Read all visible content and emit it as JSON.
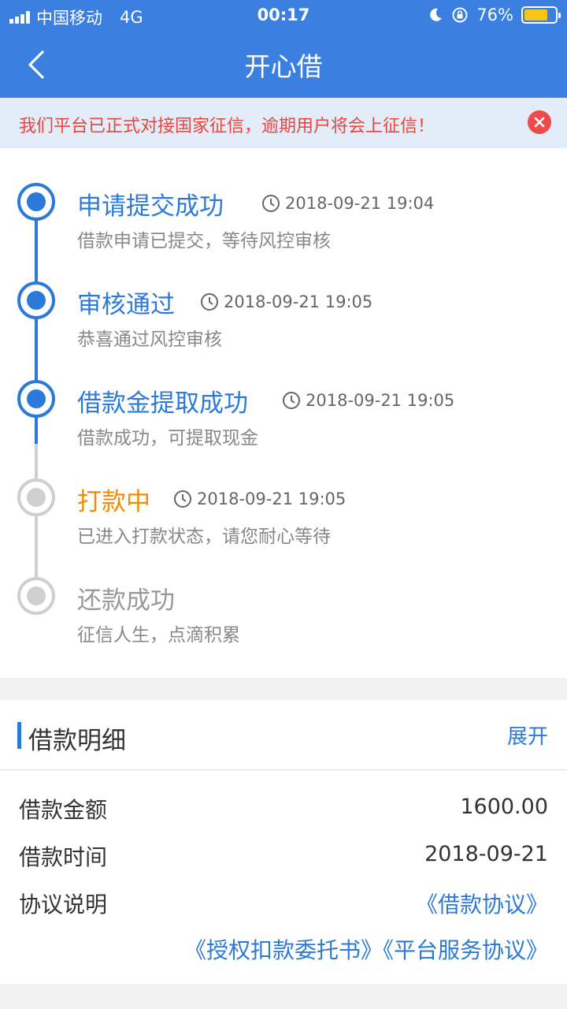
{
  "status_bar": {
    "carrier": "中国移动",
    "network": "4G",
    "time": "00:17",
    "battery": "76%",
    "battery_fill": 0.76
  },
  "nav": {
    "title": "开心借"
  },
  "notice": {
    "text": "我们平台已正式对接国家征信，逾期用户将会上征信！"
  },
  "timeline": {
    "steps": [
      {
        "label": "申请提交成功",
        "time": "2018-09-21 19:04",
        "desc": "借款申请已提交，等待风控审核",
        "state": "done"
      },
      {
        "label": "审核通过",
        "time": "2018-09-21 19:05",
        "desc": "恭喜通过风控审核",
        "state": "done"
      },
      {
        "label": "借款金提取成功",
        "time": "2018-09-21 19:05",
        "desc": "借款成功，可提取现金",
        "state": "done"
      },
      {
        "label": "打款中",
        "time": "2018-09-21 19:05",
        "desc": "已进入打款状态，请您耐心等待",
        "state": "current"
      },
      {
        "label": "还款成功",
        "time": "",
        "desc": "征信人生，点滴积累",
        "state": "pending"
      }
    ]
  },
  "details": {
    "title": "借款明细",
    "expand": "展开",
    "amount_label": "借款金额",
    "amount_value": "1600.00",
    "date_label": "借款时间",
    "date_value": "2018-09-21",
    "agreement_label": "协议说明",
    "link_loan": "《借款协议》",
    "link_authorization": "《授权扣款委托书》",
    "link_platform": "《平台服务协议》"
  },
  "colors": {
    "primary": "#3b7fe0",
    "accent": "#2b7ad9",
    "warning": "#f08c00",
    "danger": "#e8463c",
    "inactive": "#cfcfcf"
  }
}
